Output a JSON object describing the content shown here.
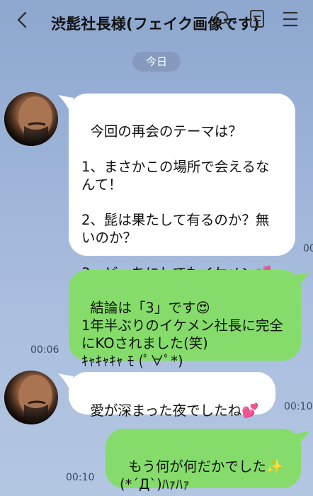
{
  "header": {
    "title": "渋髭社長様(フェイク画像です)"
  },
  "date_label": "今日",
  "messages": [
    {
      "side": "left",
      "text": "今回の再会のテーマは？\n\n1、まさかこの場所で会えるなんて！\n\n2、髭は果たして有るのか？無いのか？\n\n3、どっちにしてもイケメン",
      "emoji": "💕",
      "time": "00"
    },
    {
      "side": "right",
      "text": "結論は「3」です",
      "emoji": "😍",
      "text2": "1年半ぶりのイケメン社長に完全にKOされました(笑)\nｷｬｷｬｷｬ ﾓ (ﾟ∀ﾟ*)",
      "time": "00:06"
    },
    {
      "side": "left",
      "text": "愛が深まった夜でしたね",
      "emoji": "💕",
      "time": "00:10"
    },
    {
      "side": "right",
      "text": "もう何が何だかでした",
      "emoji": "✨",
      "text2": "(*´Д`)ﾊｧﾊｧ",
      "time": "00:10"
    }
  ],
  "icons": [
    "back-chevron-icon",
    "search-icon",
    "memo-icon",
    "menu-icon"
  ],
  "colors": {
    "background": "#9bb2d7",
    "bubble_left": "#ffffff",
    "bubble_right": "#85dc6a"
  }
}
